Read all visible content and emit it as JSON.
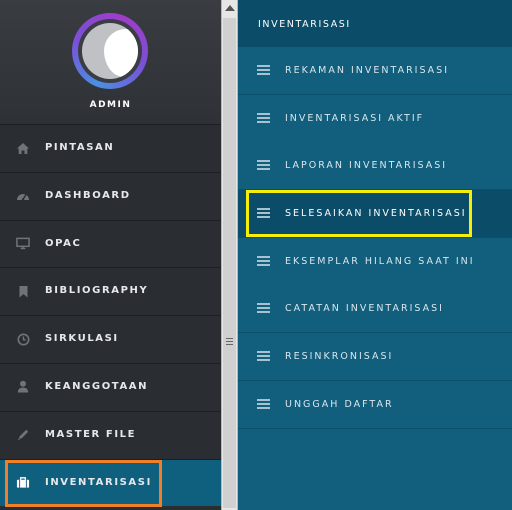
{
  "sidebar": {
    "user": {
      "name": "ADMIN"
    },
    "items": [
      {
        "label": "PINTASAN",
        "icon": "home-icon"
      },
      {
        "label": "DASHBOARD",
        "icon": "dashboard-icon"
      },
      {
        "label": "OPAC",
        "icon": "monitor-icon"
      },
      {
        "label": "BIBLIOGRAPHY",
        "icon": "bookmark-icon"
      },
      {
        "label": "SIRKULASI",
        "icon": "clock-icon"
      },
      {
        "label": "KEANGGOTAAN",
        "icon": "user-icon"
      },
      {
        "label": "MASTER FILE",
        "icon": "pencil-icon"
      },
      {
        "label": "INVENTARISASI",
        "icon": "briefcase-icon",
        "active": true
      }
    ]
  },
  "submenu": {
    "title": "INVENTARISASI",
    "items": [
      {
        "label": "REKAMAN INVENTARISASI"
      },
      {
        "label": "INVENTARISASI AKTIF"
      },
      {
        "label": "LAPORAN INVENTARISASI"
      },
      {
        "label": "SELESAIKAN INVENTARISASI",
        "highlighted": true
      },
      {
        "label": "EKSEMPLAR HILANG SAAT INI"
      },
      {
        "label": "CATATAN INVENTARISASI"
      },
      {
        "label": "RESINKRONISASI"
      },
      {
        "label": "UNGGAH DAFTAR"
      }
    ]
  },
  "colors": {
    "sidebar_bg": "#2a2e33",
    "active_bg": "#0f5f7f",
    "submenu_bg": "#125e7d",
    "submenu_header_bg": "#0b4d68",
    "highlight_orange": "#f07f28",
    "highlight_yellow": "#f5ee08"
  }
}
